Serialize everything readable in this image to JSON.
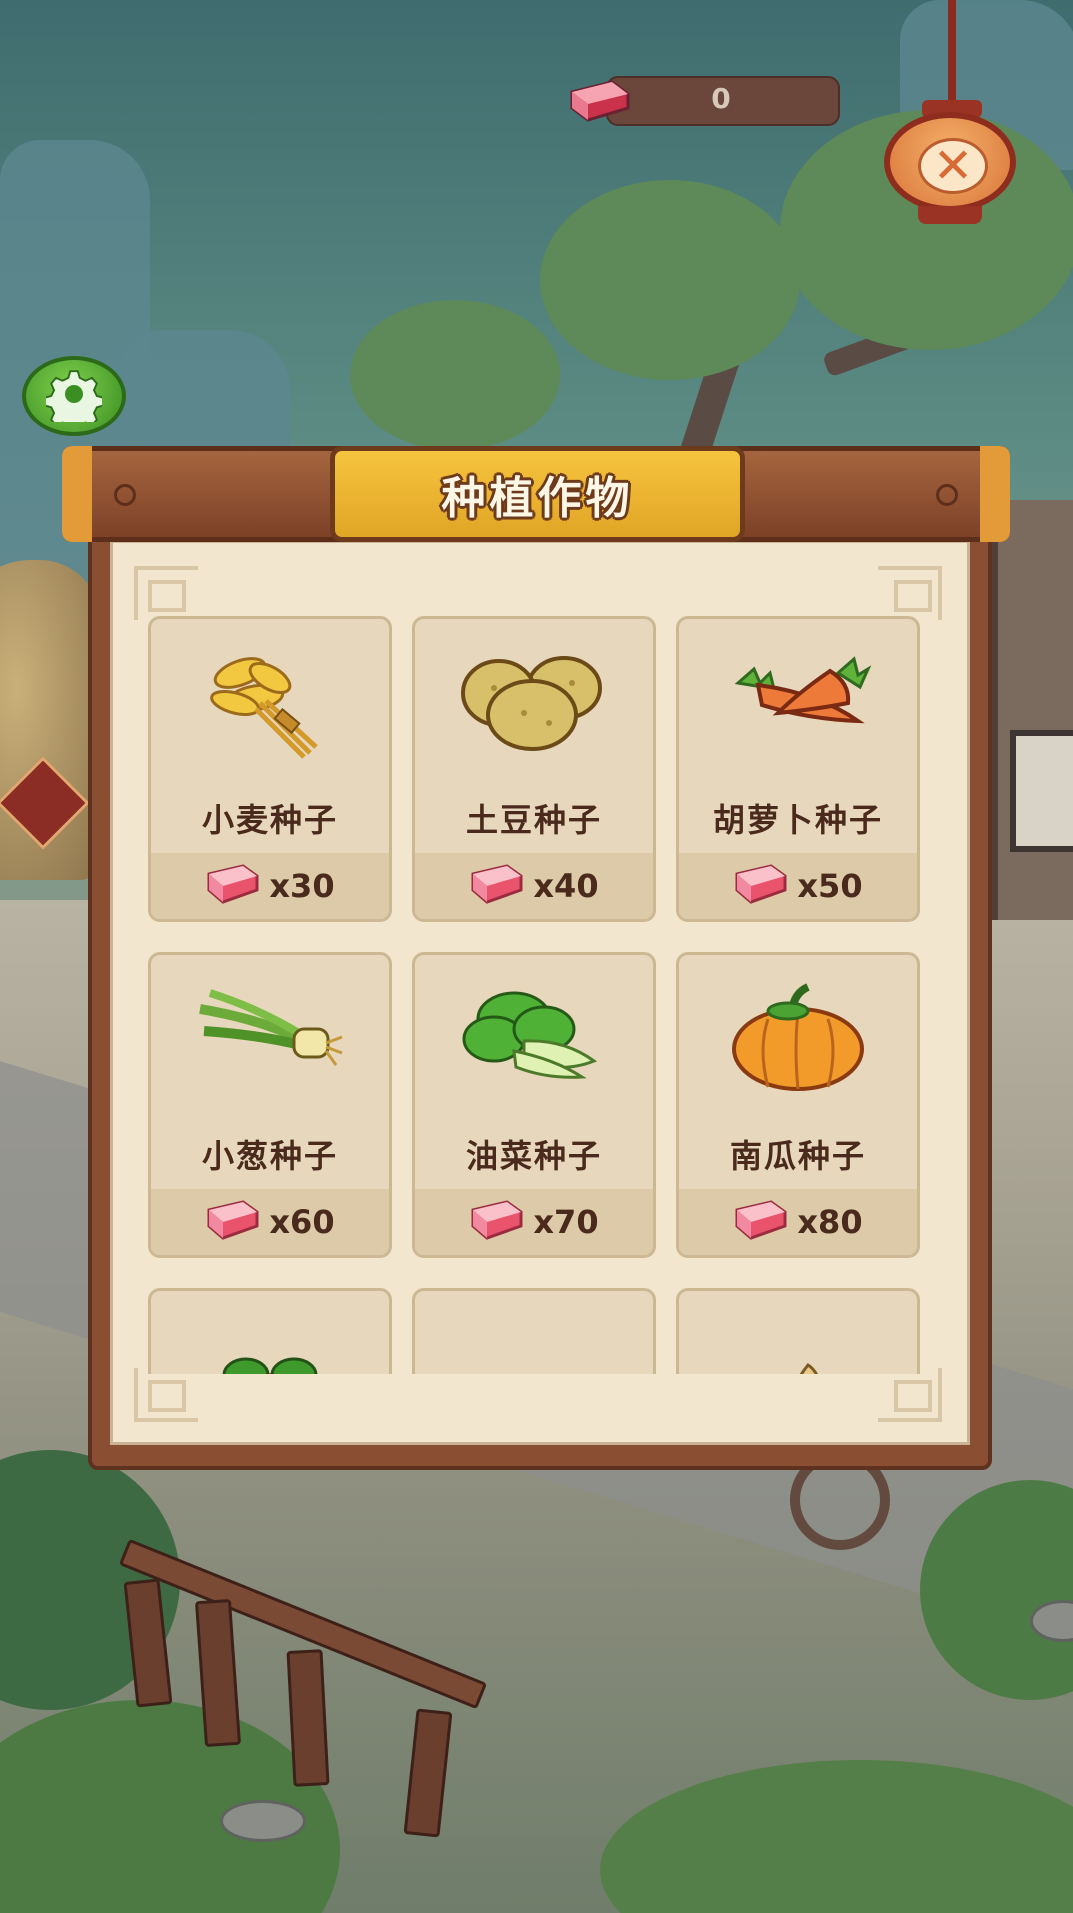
{
  "hud": {
    "currency_value": "0"
  },
  "panel": {
    "title": "种植作物"
  },
  "seeds": [
    {
      "name": "小麦种子",
      "price": "x30",
      "icon": "wheat-icon"
    },
    {
      "name": "土豆种子",
      "price": "x40",
      "icon": "potato-icon"
    },
    {
      "name": "胡萝卜种子",
      "price": "x50",
      "icon": "carrot-icon"
    },
    {
      "name": "小葱种子",
      "price": "x60",
      "icon": "scallion-icon"
    },
    {
      "name": "油菜种子",
      "price": "x70",
      "icon": "bok-choy-icon"
    },
    {
      "name": "南瓜种子",
      "price": "x80",
      "icon": "pumpkin-icon"
    }
  ],
  "partial_seeds": [
    {
      "icon": "radish-icon"
    },
    {
      "icon": "bundle-icon"
    },
    {
      "icon": "ginseng-icon"
    }
  ],
  "icons": {
    "close": "close-icon",
    "settings": "gear-icon",
    "currency": "meat-gem-icon"
  },
  "colors": {
    "title_plate": "#f6c43e",
    "panel_wood": "#8a4f33",
    "card_bg": "#e7d7bc",
    "text_brown": "#4a2a1c"
  }
}
